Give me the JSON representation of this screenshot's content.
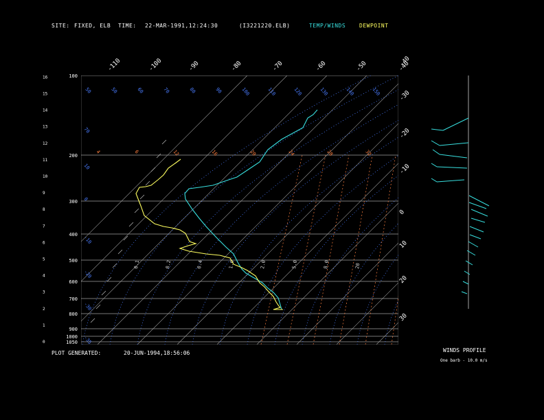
{
  "header": {
    "site_label": "SITE:",
    "site_value": "FIXED, ELB",
    "time_label": "TIME:",
    "time_value": "22-MAR-1991,12:24:30",
    "file": "(I3221220.ELB)",
    "legend_temp": "TEMP/WINDS",
    "legend_dew": "DEWPOINT"
  },
  "footer": {
    "generated_label": "PLOT GENERATED:",
    "generated_value": "20-JUN-1994,18:56:06",
    "winds_title": "WINDS PROFILE",
    "winds_note": "One barb - 10.0 m/s"
  },
  "colors": {
    "temp": "#38e0e0",
    "dew": "#ffff60",
    "dry_adiabat": "#4a7cff",
    "mixing_ratio": "#ff8040",
    "grid": "#a0a0a0"
  },
  "chart_data": {
    "type": "line",
    "left_scale": [
      "0",
      "1",
      "2",
      "3",
      "4",
      "5",
      "6",
      "7",
      "8",
      "9",
      "10",
      "11",
      "12",
      "13",
      "14",
      "15",
      "16"
    ],
    "pressure_levels": [
      "1050",
      "1000",
      "900",
      "800",
      "700",
      "600",
      "500",
      "400",
      "300",
      "200",
      "100"
    ],
    "right_temp_labels": [
      "-40",
      "-30",
      "-20",
      "-10",
      "0",
      "10",
      "20",
      "30"
    ],
    "top_temp_labels": [
      "-110",
      "-100",
      "-90",
      "-80",
      "-70",
      "-60",
      "-50",
      "-40"
    ],
    "upper_theta_labels": [
      "50",
      "50",
      "60",
      "70",
      "80",
      "90",
      "100",
      "110",
      "120",
      "130",
      "140",
      "150"
    ],
    "left_theta_labels": [
      "90",
      "70",
      "10",
      "0",
      "-10",
      "-20",
      "-30",
      "-35"
    ],
    "mixing_ratio_labels_top": [
      "4",
      "6",
      "12",
      "16",
      "20",
      "24",
      "28",
      "32"
    ],
    "mixing_ratio_labels_low": [
      "0.1",
      "0.2",
      "0.4",
      "1.0",
      "2.0",
      "5.0",
      "8.0",
      "20"
    ],
    "series": [
      {
        "name": "TEMP/WINDS",
        "points": [
          [
            462,
            160
          ],
          [
            456,
            167
          ],
          [
            448,
            172
          ],
          [
            441,
            186
          ],
          [
            430,
            192
          ],
          [
            410,
            203
          ],
          [
            390,
            218
          ],
          [
            378,
            236
          ],
          [
            360,
            248
          ],
          [
            345,
            258
          ],
          [
            330,
            263
          ],
          [
            310,
            270
          ],
          [
            290,
            273
          ],
          [
            275,
            275
          ],
          [
            269,
            282
          ],
          [
            270,
            290
          ],
          [
            280,
            305
          ],
          [
            290,
            318
          ],
          [
            300,
            330
          ],
          [
            315,
            346
          ],
          [
            329,
            360
          ],
          [
            340,
            370
          ],
          [
            346,
            382
          ],
          [
            352,
            392
          ],
          [
            358,
            398
          ],
          [
            370,
            405
          ],
          [
            382,
            412
          ],
          [
            390,
            420
          ],
          [
            398,
            426
          ],
          [
            405,
            434
          ],
          [
            408,
            444
          ],
          [
            410,
            451
          ]
        ]
      },
      {
        "name": "DEWPOINT",
        "points": [
          [
            263,
            232
          ],
          [
            255,
            238
          ],
          [
            245,
            245
          ],
          [
            238,
            255
          ],
          [
            230,
            262
          ],
          [
            220,
            270
          ],
          [
            212,
            272
          ],
          [
            203,
            273
          ],
          [
            198,
            282
          ],
          [
            205,
            300
          ],
          [
            210,
            314
          ],
          [
            225,
            326
          ],
          [
            238,
            330
          ],
          [
            250,
            332
          ],
          [
            262,
            335
          ],
          [
            270,
            340
          ],
          [
            276,
            352
          ],
          [
            285,
            355
          ],
          [
            274,
            358
          ],
          [
            262,
            362
          ],
          [
            275,
            366
          ],
          [
            300,
            370
          ],
          [
            320,
            372
          ],
          [
            335,
            376
          ],
          [
            340,
            385
          ],
          [
            352,
            390
          ],
          [
            360,
            394
          ],
          [
            372,
            402
          ],
          [
            378,
            412
          ],
          [
            385,
            418
          ],
          [
            392,
            426
          ],
          [
            398,
            432
          ],
          [
            402,
            440
          ],
          [
            406,
            446
          ],
          [
            408,
            448
          ],
          [
            398,
            451
          ],
          [
            412,
            451
          ]
        ]
      }
    ],
    "wind_profile": {
      "shaft": [
        [
          682,
          110
        ],
        [
          682,
          450
        ]
      ],
      "barbs": [
        [
          [
            682,
            172
          ],
          [
            645,
            190
          ]
        ],
        [
          [
            645,
            190
          ],
          [
            628,
            188
          ]
        ],
        [
          [
            682,
            208
          ],
          [
            640,
            212
          ]
        ],
        [
          [
            640,
            212
          ],
          [
            628,
            205
          ]
        ],
        [
          [
            680,
            230
          ],
          [
            640,
            225
          ]
        ],
        [
          [
            640,
            225
          ],
          [
            630,
            218
          ]
        ],
        [
          [
            680,
            245
          ],
          [
            636,
            243
          ]
        ],
        [
          [
            636,
            243
          ],
          [
            628,
            238
          ]
        ],
        [
          [
            676,
            262
          ],
          [
            636,
            265
          ]
        ],
        [
          [
            636,
            265
          ],
          [
            628,
            260
          ]
        ],
        [
          [
            683,
            285
          ],
          [
            712,
            300
          ]
        ],
        [
          [
            683,
            295
          ],
          [
            708,
            304
          ]
        ],
        [
          [
            686,
            305
          ],
          [
            710,
            315
          ]
        ],
        [
          [
            686,
            318
          ],
          [
            706,
            324
          ]
        ],
        [
          [
            684,
            330
          ],
          [
            704,
            338
          ]
        ],
        [
          [
            684,
            342
          ],
          [
            700,
            348
          ]
        ],
        [
          [
            682,
            352
          ],
          [
            696,
            360
          ]
        ],
        [
          [
            680,
            365
          ],
          [
            692,
            372
          ]
        ],
        [
          [
            678,
            380
          ],
          [
            688,
            386
          ]
        ],
        [
          [
            676,
            395
          ],
          [
            684,
            400
          ]
        ],
        [
          [
            674,
            410
          ],
          [
            682,
            414
          ]
        ],
        [
          [
            672,
            425
          ],
          [
            680,
            428
          ]
        ]
      ]
    }
  }
}
